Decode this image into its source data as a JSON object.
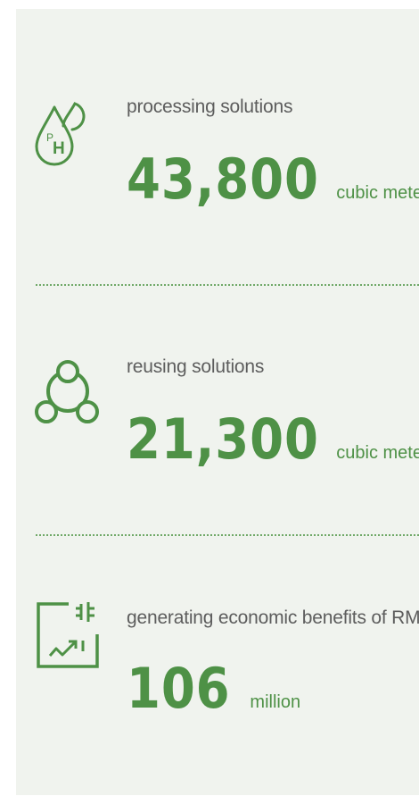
{
  "stats": [
    {
      "icon": "ph-droplet-icon",
      "label": "processing solutions",
      "value": "43,800",
      "unit": "cubic meters"
    },
    {
      "icon": "recycle-circle-icon",
      "label": "reusing solutions",
      "value": "21,300",
      "unit": "cubic meters"
    },
    {
      "icon": "economic-growth-chart-icon",
      "label": "generating economic benefits of RMB",
      "value": "106",
      "unit": "million"
    }
  ],
  "colors": {
    "accent": "#4e9146",
    "label": "#5d5d5d",
    "panel_background": "#f0f3ee",
    "divider": "#6fa867"
  }
}
